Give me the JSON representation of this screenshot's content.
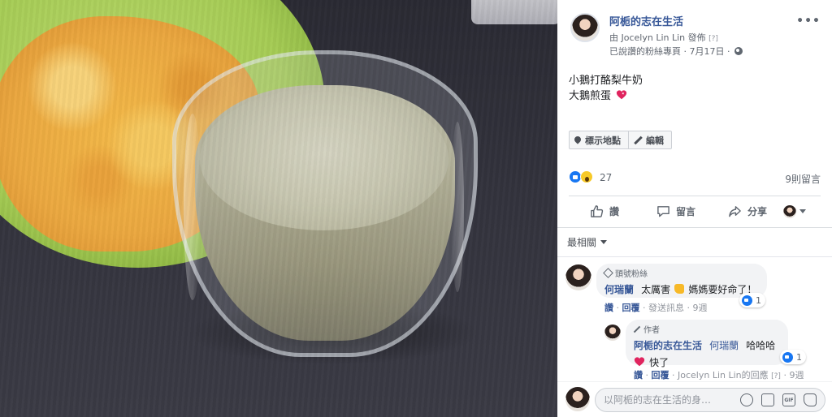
{
  "post": {
    "page_name": "阿栀的志在生活",
    "posted_by": "由 Jocelyn Lin Lin 發佈",
    "posted_by_help": "[?]",
    "meta": "已說讚的粉絲專頁 · 7月17日 ·",
    "text_line1": "小鵝打酪梨牛奶",
    "text_line2": "大鵝煎蛋",
    "more_icon": "more-horizontal-icon"
  },
  "tag_buttons": {
    "location_label": "標示地點",
    "edit_label": "編輯"
  },
  "reactions": {
    "count": "27",
    "comments": "9則留言",
    "types": [
      "like",
      "wow"
    ]
  },
  "actions": {
    "like": "讚",
    "comment": "留言",
    "share": "分享"
  },
  "sort": {
    "label": "最相關"
  },
  "comments": [
    {
      "badge": "頭號粉絲",
      "author": "何瑞蘭",
      "text_before": "太厲害",
      "text_after": "媽媽要好命了！",
      "reaction_count": "1",
      "like": "讚",
      "reply": "回覆",
      "message": "發送訊息",
      "time": "9週"
    },
    {
      "badge": "作者",
      "author": "阿栀的志在生活",
      "mention": "何瑞蘭",
      "text_before": "哈哈哈",
      "text_after": "快了",
      "reaction_count": "1",
      "like": "讚",
      "reply": "回覆",
      "reply_meta": "Jocelyn Lin Lin的回應",
      "help": "[?]",
      "time": "9週"
    }
  ],
  "composer": {
    "placeholder": "以阿栀的志在生活的身…"
  },
  "colors": {
    "link": "#385898",
    "like_blue": "#1877f2",
    "wow_yellow": "#f7c928",
    "heart_red": "#e0245e"
  }
}
